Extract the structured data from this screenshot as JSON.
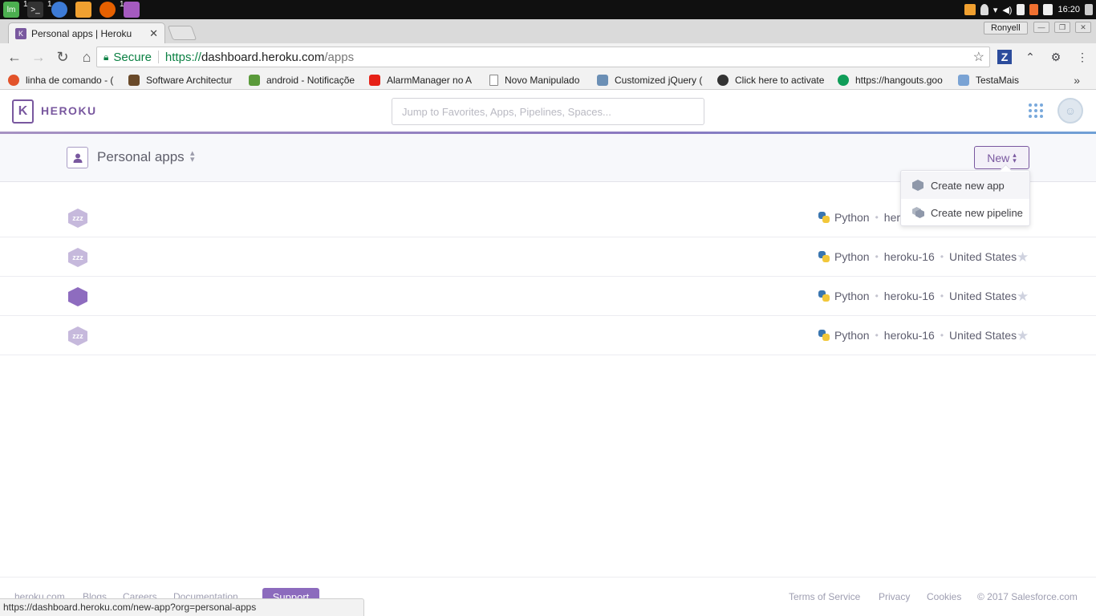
{
  "taskbar": {
    "apps": [
      {
        "name": "mint",
        "badge": "",
        "color": "#4caf50",
        "glyph": "lm"
      },
      {
        "name": "terminal",
        "badge": "1",
        "color": "#333",
        "glyph": ">_"
      },
      {
        "name": "chrome",
        "badge": "1",
        "color": "#e0a030",
        "glyph": "◉"
      },
      {
        "name": "files",
        "badge": "",
        "color": "#f0a030",
        "glyph": "▬"
      },
      {
        "name": "firefox",
        "badge": "",
        "color": "#e66000",
        "glyph": "●"
      },
      {
        "name": "editor",
        "badge": "1",
        "color": "#a55bbf",
        "glyph": "▤"
      }
    ],
    "clock": "16:20"
  },
  "browser": {
    "tab_title": "Personal apps | Heroku",
    "tab_favicon": "K",
    "user_name": "Ronyell",
    "secure_label": "Secure",
    "url_scheme": "https://",
    "url_host": "dashboard.heroku.com",
    "url_path": "/apps",
    "bookmarks": [
      {
        "label": "linha de comando - (",
        "color": "#e2532a"
      },
      {
        "label": "Software Architectur",
        "color": "#6a4a2a"
      },
      {
        "label": "android - Notificaçõe",
        "color": "#5a9a3a"
      },
      {
        "label": "AlarmManager no A",
        "color": "#e62117"
      },
      {
        "label": "Novo Manipulado",
        "color": "#ffffff"
      },
      {
        "label": "Customized jQuery (",
        "color": "#6b8fb5"
      },
      {
        "label": "Click here to activate",
        "color": "#333333"
      },
      {
        "label": "https://hangouts.goo",
        "color": "#0f9d58"
      },
      {
        "label": "TestaMais",
        "color": "#7aa3d4"
      }
    ],
    "bookmarks_more": "»",
    "status_url": "https://dashboard.heroku.com/new-app?org=personal-apps"
  },
  "heroku": {
    "brand": "HEROKU",
    "logo_glyph": "K",
    "search_placeholder": "Jump to Favorites, Apps, Pipelines, Spaces...",
    "context_label": "Personal apps",
    "new_button": "New",
    "dropdown": {
      "create_app": "Create new app",
      "create_pipeline": "Create new pipeline"
    },
    "apps": [
      {
        "state": "sleep",
        "badge": "zzz",
        "language": "Python",
        "stack": "herok",
        "region": "",
        "favorite_visible": false
      },
      {
        "state": "sleep",
        "badge": "zzz",
        "language": "Python",
        "stack": "heroku-16",
        "region": "United States",
        "favorite_visible": true
      },
      {
        "state": "active",
        "badge": "",
        "language": "Python",
        "stack": "heroku-16",
        "region": "United States",
        "favorite_visible": true
      },
      {
        "state": "sleep",
        "badge": "zzz",
        "language": "Python",
        "stack": "heroku-16",
        "region": "United States",
        "favorite_visible": true
      }
    ],
    "footer": {
      "links_left": [
        "heroku.com",
        "Blogs",
        "Careers",
        "Documentation"
      ],
      "support": "Support",
      "links_right": [
        "Terms of Service",
        "Privacy",
        "Cookies",
        "© 2017 Salesforce.com"
      ]
    }
  }
}
